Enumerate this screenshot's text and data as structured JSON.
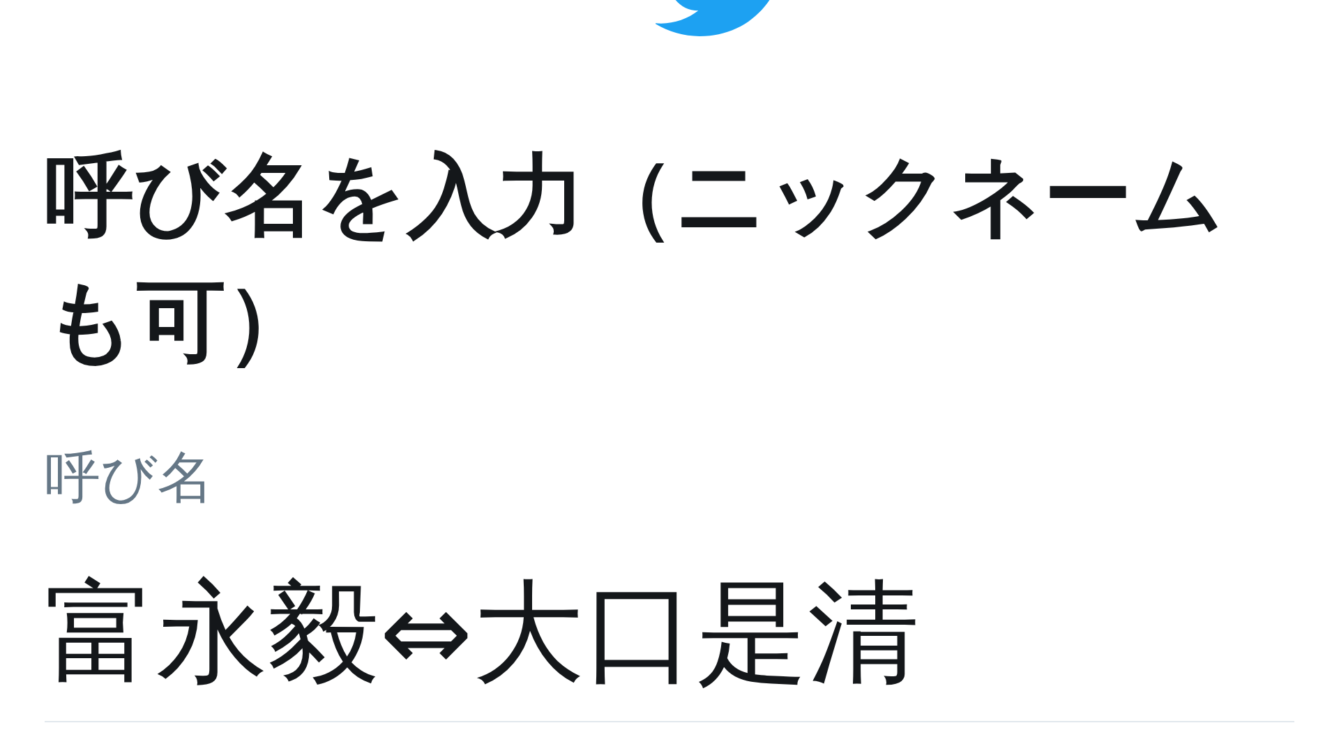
{
  "heading": "呼び名を入力（ニックネームも可）",
  "field": {
    "label": "呼び名",
    "value": "富永毅⇔大口是清"
  }
}
